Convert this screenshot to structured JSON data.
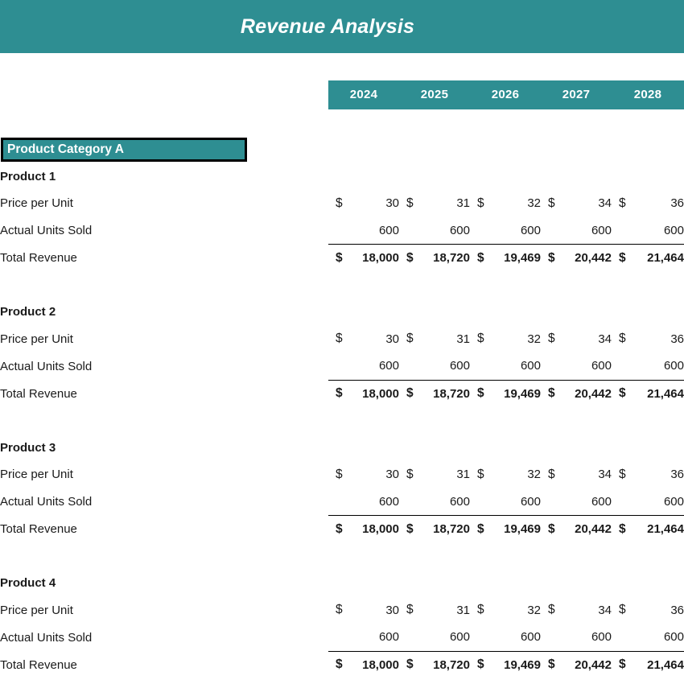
{
  "title": "Revenue Analysis",
  "header": {
    "years": [
      "2024",
      "2025",
      "2026",
      "2027",
      "2028"
    ]
  },
  "category": {
    "label": "Product Category A"
  },
  "row_labels": {
    "price": "Price per Unit",
    "units": "Actual Units Sold",
    "total": "Total Revenue"
  },
  "currency_symbol": "$",
  "products": [
    {
      "name": "Product 1",
      "price_per_unit": [
        "30",
        "31",
        "32",
        "34",
        "36"
      ],
      "actual_units_sold": [
        "600",
        "600",
        "600",
        "600",
        "600"
      ],
      "total_revenue": [
        "18,000",
        "18,720",
        "19,469",
        "20,442",
        "21,464"
      ]
    },
    {
      "name": "Product 2",
      "price_per_unit": [
        "30",
        "31",
        "32",
        "34",
        "36"
      ],
      "actual_units_sold": [
        "600",
        "600",
        "600",
        "600",
        "600"
      ],
      "total_revenue": [
        "18,000",
        "18,720",
        "19,469",
        "20,442",
        "21,464"
      ]
    },
    {
      "name": "Product 3",
      "price_per_unit": [
        "30",
        "31",
        "32",
        "34",
        "36"
      ],
      "actual_units_sold": [
        "600",
        "600",
        "600",
        "600",
        "600"
      ],
      "total_revenue": [
        "18,000",
        "18,720",
        "19,469",
        "20,442",
        "21,464"
      ]
    },
    {
      "name": "Product 4",
      "price_per_unit": [
        "30",
        "31",
        "32",
        "34",
        "36"
      ],
      "actual_units_sold": [
        "600",
        "600",
        "600",
        "600",
        "600"
      ],
      "total_revenue": [
        "18,000",
        "18,720",
        "19,469",
        "20,442",
        "21,464"
      ]
    }
  ],
  "colors": {
    "accent_teal": "#2e8e92",
    "header_text": "#ffffff",
    "body_text": "#1a1a1a"
  },
  "chart_data": {
    "type": "table",
    "title": "Revenue Analysis",
    "categories": [
      "2024",
      "2025",
      "2026",
      "2027",
      "2028"
    ],
    "row_groups": [
      {
        "group": "Product Category A",
        "products": [
          {
            "name": "Product 1",
            "series": [
              {
                "name": "Price per Unit",
                "values": [
                  30,
                  31,
                  32,
                  34,
                  36
                ]
              },
              {
                "name": "Actual Units Sold",
                "values": [
                  600,
                  600,
                  600,
                  600,
                  600
                ]
              },
              {
                "name": "Total Revenue",
                "values": [
                  18000,
                  18720,
                  19469,
                  20442,
                  21464
                ]
              }
            ]
          },
          {
            "name": "Product 2",
            "series": [
              {
                "name": "Price per Unit",
                "values": [
                  30,
                  31,
                  32,
                  34,
                  36
                ]
              },
              {
                "name": "Actual Units Sold",
                "values": [
                  600,
                  600,
                  600,
                  600,
                  600
                ]
              },
              {
                "name": "Total Revenue",
                "values": [
                  18000,
                  18720,
                  19469,
                  20442,
                  21464
                ]
              }
            ]
          },
          {
            "name": "Product 3",
            "series": [
              {
                "name": "Price per Unit",
                "values": [
                  30,
                  31,
                  32,
                  34,
                  36
                ]
              },
              {
                "name": "Actual Units Sold",
                "values": [
                  600,
                  600,
                  600,
                  600,
                  600
                ]
              },
              {
                "name": "Total Revenue",
                "values": [
                  18000,
                  18720,
                  19469,
                  20442,
                  21464
                ]
              }
            ]
          },
          {
            "name": "Product 4",
            "series": [
              {
                "name": "Price per Unit",
                "values": [
                  30,
                  31,
                  32,
                  34,
                  36
                ]
              },
              {
                "name": "Actual Units Sold",
                "values": [
                  600,
                  600,
                  600,
                  600,
                  600
                ]
              },
              {
                "name": "Total Revenue",
                "values": [
                  18000,
                  18720,
                  19469,
                  20442,
                  21464
                ]
              }
            ]
          }
        ]
      }
    ],
    "xlabel": "",
    "ylabel": "",
    "grid": false,
    "legend": "none"
  }
}
